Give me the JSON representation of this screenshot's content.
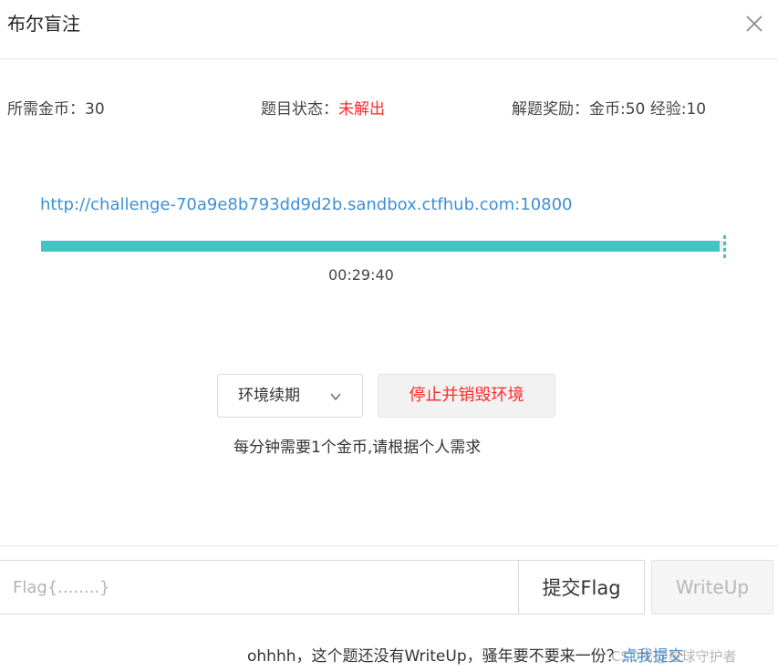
{
  "dialog": {
    "title": "布尔盲注",
    "close_icon": "close-icon"
  },
  "info": {
    "cost_label": "所需金币：",
    "cost_value": "30",
    "status_label": "题目状态：",
    "status_value": "未解出",
    "reward_label": "解题奖励：",
    "reward_value": "金币:50 经验:10"
  },
  "environment": {
    "url": "http://challenge-70a9e8b793dd9d2b.sandbox.ctfhub.com:10800",
    "progress_fraction": 0.99,
    "timer": "00:29:40",
    "renew_label": "环境续期",
    "stop_label": "停止并销毁环境",
    "cost_note": "每分钟需要1个金币,请根据个人需求"
  },
  "flag": {
    "placeholder": "Flag{........}",
    "submit_label": "提交Flag",
    "writeup_label": "WriteUp"
  },
  "footer": {
    "note": "ohhhh，这个题还没有WriteUp，骚年要不要来一份？",
    "link": "点我提交",
    "watermark": "CSDN @星球守护者"
  },
  "colors": {
    "accent": "#45c2c2",
    "link": "#3d8fd6",
    "danger": "#ff2a2a"
  }
}
